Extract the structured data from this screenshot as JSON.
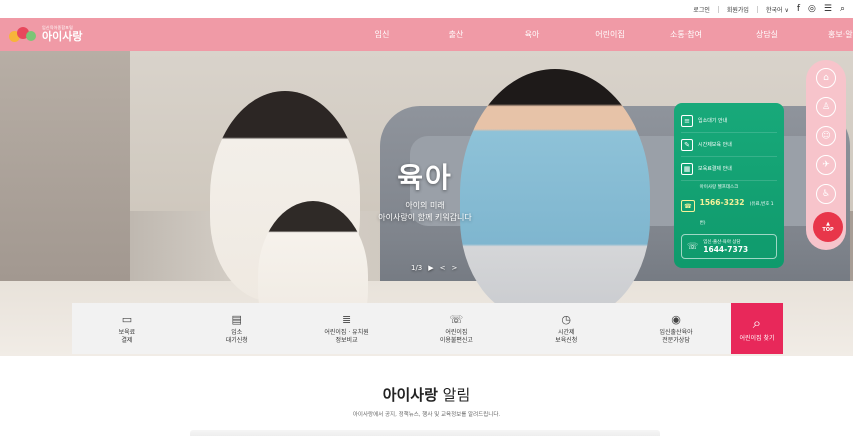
{
  "util_bar": {
    "login": "로그인",
    "signup": "회원가입",
    "language": "한국어",
    "lang_arrow": "∨",
    "icons": [
      "facebook-icon",
      "instagram-icon",
      "menu-icon",
      "search-icon"
    ]
  },
  "header": {
    "logo_sub": "임신육아종합포털",
    "logo_main": "아이사랑",
    "menu": [
      "임신",
      "출산",
      "육아",
      "어린이집",
      "소통·참여",
      "상담실",
      "홍보·알림"
    ]
  },
  "hero": {
    "title": "육아",
    "subtitle_1": "아이의 미래",
    "subtitle_2": "아이사랑이 함께 키워갑니다",
    "pager": "1/3",
    "play": "▶",
    "prev": "<",
    "next": ">"
  },
  "green_panel": {
    "items": [
      "입소대기 안내",
      "시간제보육 안내",
      "보육료결제 안내"
    ],
    "helpdesk_label": "아이사랑 헬프데스크",
    "helpdesk_number": "1566-3232",
    "helpdesk_note": "(유료,번호 1번)",
    "consult_label": "임신·출산·육아 상담",
    "consult_number": "1644-7373"
  },
  "rail": {
    "icons": [
      "home-icon",
      "baby-bottle-icon",
      "baby-face-icon",
      "toy-icon",
      "stroller-icon"
    ],
    "top": "TOP"
  },
  "services": [
    {
      "line1": "보육료",
      "line2": "결제",
      "icon": "card-icon"
    },
    {
      "line1": "입소",
      "line2": "대기신청",
      "icon": "calendar-icon"
    },
    {
      "line1": "어린이집 · 유치원",
      "line2": "정보비교",
      "icon": "compare-icon"
    },
    {
      "line1": "어린이집",
      "line2": "이용불편신고",
      "icon": "report-icon"
    },
    {
      "line1": "시간제",
      "line2": "보육신청",
      "icon": "clock-icon"
    },
    {
      "line1": "임신출산육아",
      "line2": "전문가상담",
      "icon": "expert-icon"
    }
  ],
  "find": {
    "label": "어린이집 찾기"
  },
  "notice": {
    "title_bold": "아이사랑",
    "title_light": " 알림",
    "desc": "아이사랑에서 공지, 정책뉴스, 행사 및 교육정보를 알려드립니다."
  },
  "colors": {
    "brand_pink": "#f09aa6",
    "accent_red": "#e8285a",
    "panel_green": "#18a97a"
  }
}
